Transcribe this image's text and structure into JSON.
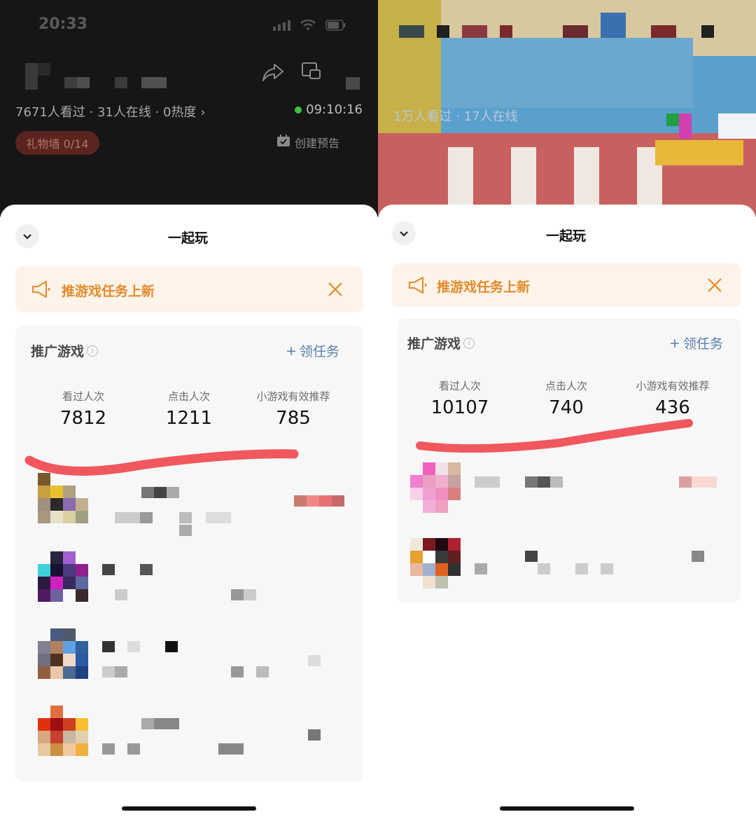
{
  "left": {
    "status_time": "20:33",
    "stats_line": "7671人看过 · 31人在线 · 0热度",
    "stats_chevron": "›",
    "timer": "09:10:16",
    "gift_wall": "礼物墙 0/14",
    "create_preview": "创建预告",
    "sheet_title": "一起玩",
    "banner_text": "推游戏任务上新",
    "card_title": "推广游戏",
    "task_link": "领任务",
    "task_link_icon": "+",
    "info_icon": "i",
    "stats": [
      {
        "label": "看过人次",
        "value": "7812"
      },
      {
        "label": "点击人次",
        "value": "1211"
      },
      {
        "label": "小游戏有效推荐",
        "value": "785"
      }
    ]
  },
  "right": {
    "stats_line": "1万人看过 · 17人在线",
    "sheet_title": "一起玩",
    "banner_text": "推游戏任务上新",
    "card_title": "推广游戏",
    "task_link": "领任务",
    "task_link_icon": "+",
    "info_icon": "i",
    "stats": [
      {
        "label": "看过人次",
        "value": "10107"
      },
      {
        "label": "点击人次",
        "value": "740"
      },
      {
        "label": "小游戏有效推荐",
        "value": "436"
      }
    ]
  },
  "colors": {
    "banner_bg": "#fdf3e8",
    "banner_text": "#e48a2c",
    "link_blue": "#5a7fb0",
    "highlight_stroke": "#f0585e",
    "live_green": "#3fbf3f"
  },
  "icons": [
    "chevron-down-icon",
    "megaphone-icon",
    "close-icon",
    "info-icon",
    "plus-icon",
    "share-icon",
    "pip-icon",
    "calendar-icon",
    "signal-icon",
    "wifi-icon",
    "battery-icon"
  ]
}
